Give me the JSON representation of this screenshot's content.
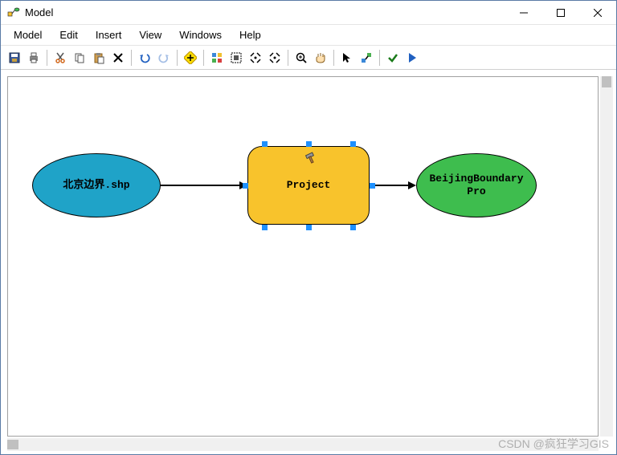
{
  "window": {
    "title": "Model"
  },
  "menubar": {
    "items": [
      "Model",
      "Edit",
      "Insert",
      "View",
      "Windows",
      "Help"
    ]
  },
  "toolbar": {
    "groups": [
      [
        "save-icon",
        "print-icon"
      ],
      [
        "cut-icon",
        "copy-icon",
        "paste-icon",
        "delete-icon"
      ],
      [
        "undo-icon",
        "redo-icon"
      ],
      [
        "add-data-icon"
      ],
      [
        "auto-layout-icon",
        "full-extent-icon",
        "zoom-in-fixed-icon",
        "zoom-out-fixed-icon"
      ],
      [
        "zoom-in-icon",
        "pan-icon"
      ],
      [
        "select-icon",
        "connect-icon"
      ],
      [
        "validate-icon",
        "run-icon"
      ]
    ]
  },
  "diagram": {
    "input": {
      "label": "北京边界.shp",
      "color": "#1fa3c8"
    },
    "process": {
      "label": "Project",
      "color": "#f8c32c",
      "selected": true
    },
    "output": {
      "label": "BeijingBoundaryPro",
      "color": "#3ebd4e"
    }
  },
  "watermark": "CSDN @疯狂学习GIS"
}
